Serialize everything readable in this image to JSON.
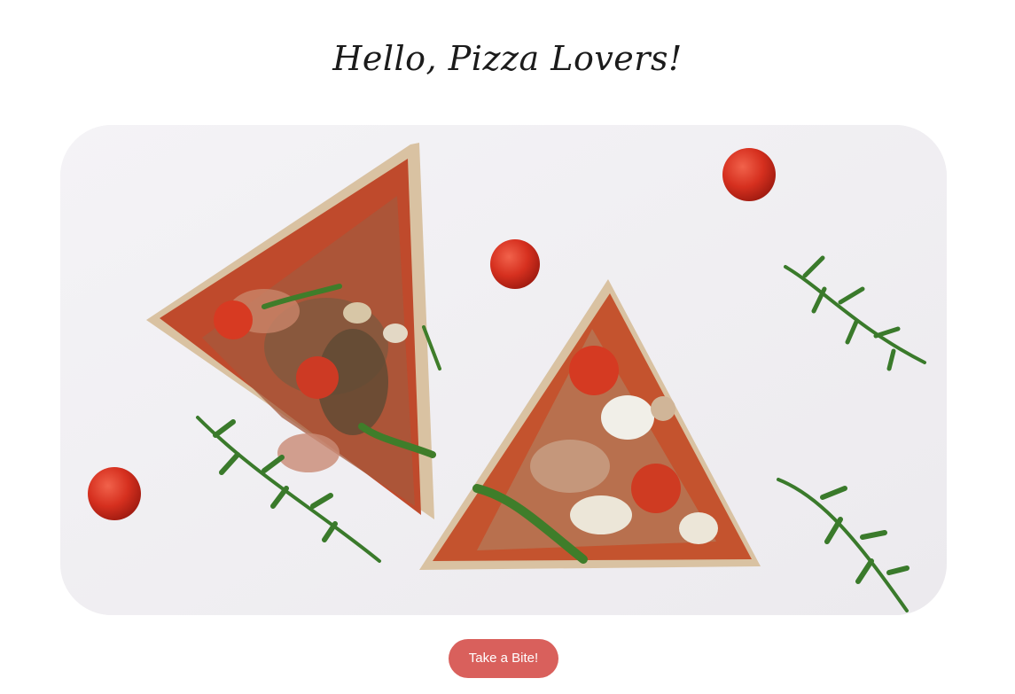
{
  "header": {
    "title": "Hello, Pizza Lovers!"
  },
  "hero": {
    "subject": "pizza-slices-illustration"
  },
  "cta": {
    "label": "Take a Bite!"
  },
  "colors": {
    "button": "#d9605c",
    "background": "#ffffff",
    "card": "#f1f0f3",
    "title": "#1b1b1b"
  }
}
